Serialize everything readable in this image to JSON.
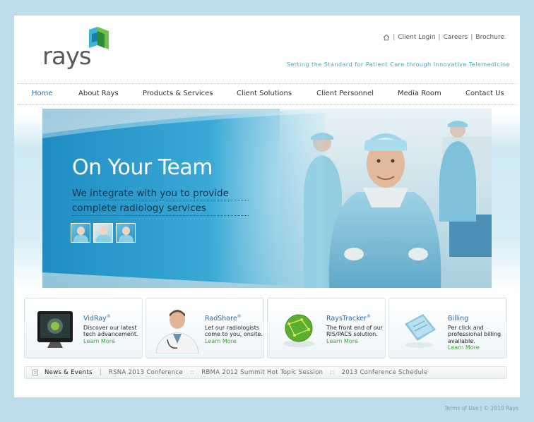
{
  "brand": {
    "name": "rays",
    "accent": "#3aa6c6",
    "link_color": "#1f6fb0"
  },
  "toplinks": {
    "home_icon": "home-icon",
    "client_login": "Client Login",
    "careers": "Careers",
    "brochure": "Brochure",
    "separator": "|"
  },
  "tagline": "Setting the Standard for Patient Care through Innovative Telemedicine",
  "nav": {
    "home": "Home",
    "about": "About Rays",
    "products": "Products & Services",
    "solutions": "Client Solutions",
    "personnel": "Client Personnel",
    "media": "Media Room",
    "contact": "Contact Us"
  },
  "hero": {
    "title": "On Your Team",
    "line1": "We integrate with you to provide",
    "line2": "complete radiology services"
  },
  "cards": [
    {
      "title": "VidRay",
      "mark": "®",
      "text": "Discover our latest tech advancement.",
      "more": "Learn More"
    },
    {
      "title": "RadShare",
      "mark": "®",
      "text": "Let our radiologists come to you, onsite.",
      "more": "Learn More"
    },
    {
      "title": "RaysTracker",
      "mark": "®",
      "text": "The front end of our RIS/PACS solution.",
      "more": "Learn More"
    },
    {
      "title": "Billing",
      "mark": "",
      "text": "Per click and professional billing available.",
      "more": "Learn More"
    }
  ],
  "news": {
    "label": "News & Events",
    "bar": "|",
    "sep": "::",
    "items": [
      "RSNA 2013 Conference",
      "RBMA 2012 Summit Hot Topic Session",
      "2013 Conference Schedule"
    ]
  },
  "footer": {
    "terms": "Terms of Use",
    "copyright": "© 2010 Rays"
  }
}
